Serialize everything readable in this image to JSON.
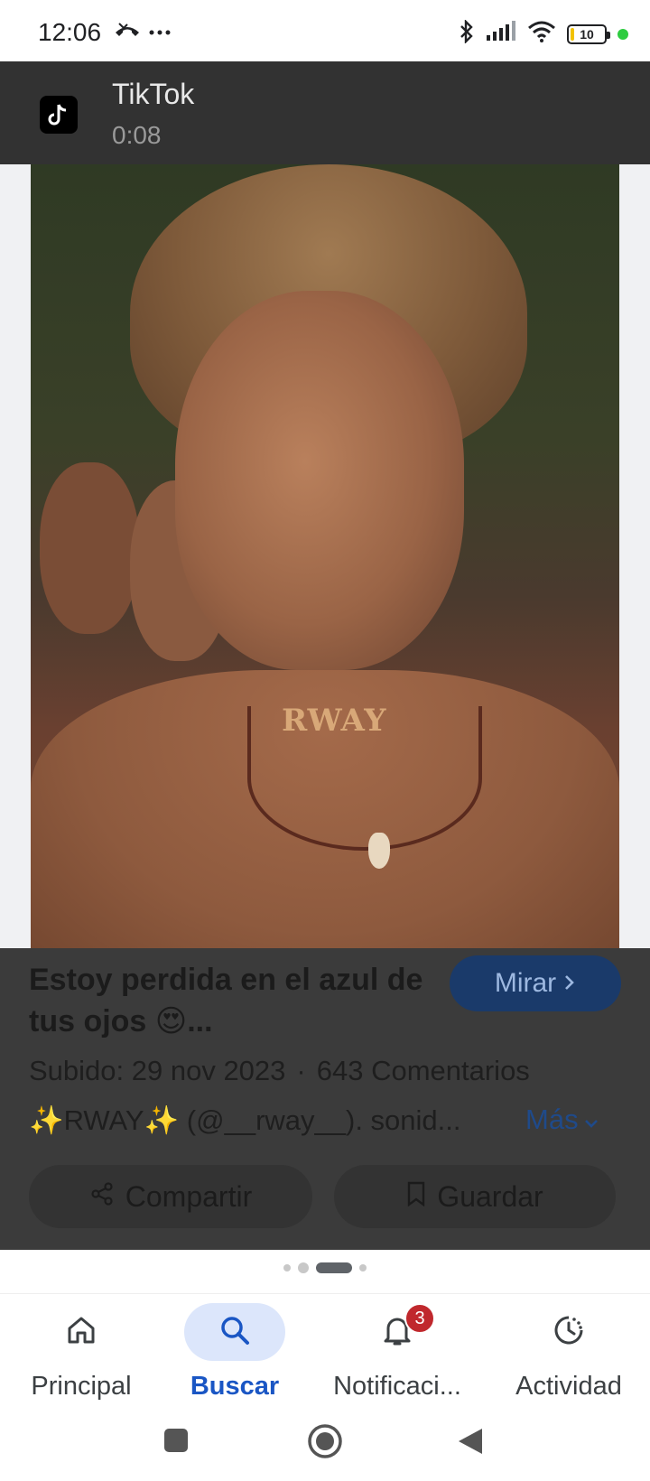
{
  "status_bar": {
    "time": "12:06",
    "battery_level": "10",
    "battery_percent": 10,
    "icons": [
      "missed-call-icon",
      "more-dots-icon",
      "bluetooth-icon",
      "signal-icon",
      "wifi-icon",
      "battery-icon",
      "privacy-dot-icon"
    ]
  },
  "source": {
    "name": "TikTok",
    "duration": "0:08"
  },
  "media": {
    "overlay_text": "RWAY"
  },
  "result": {
    "title": "Estoy perdida en el azul de tus ojos 😍...",
    "watch_label": "Mirar",
    "uploaded": "Subido: 29 nov 2023",
    "separator": "·",
    "comments": "643 Comentarios",
    "description": "✨RWAY✨ (@__rway__). sonid...",
    "more_label": "Más"
  },
  "actions": {
    "share_label": "Compartir",
    "save_label": "Guardar"
  },
  "pager": {
    "count": 4,
    "active_index": 2
  },
  "bottom_nav": {
    "items": [
      {
        "label": "Principal",
        "icon": "home-icon"
      },
      {
        "label": "Buscar",
        "icon": "search-icon",
        "active": true
      },
      {
        "label": "Notificaci...",
        "icon": "bell-icon",
        "badge": "3"
      },
      {
        "label": "Actividad",
        "icon": "activity-icon"
      }
    ]
  },
  "colors": {
    "accent": "#1a56c4",
    "watch_button_bg": "#1a3a6a",
    "badge": "#c0282d",
    "overlay": "#3b3b3b"
  }
}
